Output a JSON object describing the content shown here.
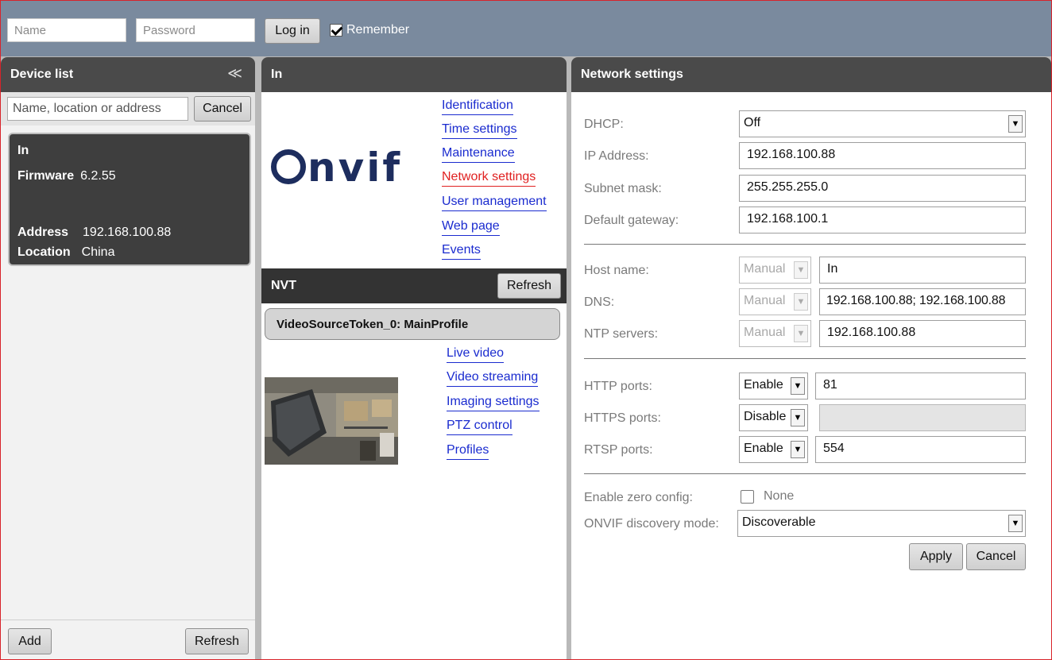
{
  "login": {
    "name_placeholder": "Name",
    "password_placeholder": "Password",
    "login_label": "Log in",
    "remember_label": "Remember"
  },
  "device_list": {
    "title": "Device list",
    "collapse_glyph": "≪",
    "search_placeholder": "Name, location or address",
    "cancel_label": "Cancel",
    "device": {
      "name": "In",
      "firmware_label": "Firmware",
      "firmware": "6.2.55",
      "address_label": "Address",
      "address": "192.168.100.88",
      "location_label": "Location",
      "location": "China"
    },
    "add_label": "Add",
    "refresh_label": "Refresh"
  },
  "device_panel": {
    "title": "In",
    "logo_text": "nvif",
    "links": [
      "Identification",
      "Time settings",
      "Maintenance",
      "Network settings",
      "User management",
      "Web page",
      "Events"
    ],
    "active_link": "Network settings",
    "nvt_title": "NVT",
    "nvt_refresh_label": "Refresh",
    "profile_label": "VideoSourceToken_0: MainProfile",
    "profile_links": [
      "Live video",
      "Video streaming",
      "Imaging settings",
      "PTZ control",
      "Profiles"
    ]
  },
  "network": {
    "title": "Network settings",
    "dhcp_label": "DHCP:",
    "dhcp_value": "Off",
    "ip_label": "IP Address:",
    "ip_value": "192.168.100.88",
    "subnet_label": "Subnet mask:",
    "subnet_value": "255.255.255.0",
    "gateway_label": "Default gateway:",
    "gateway_value": "192.168.100.1",
    "host_label": "Host name:",
    "host_mode": "Manual",
    "host_value": "In",
    "dns_label": "DNS:",
    "dns_mode": "Manual",
    "dns_value": "192.168.100.88; 192.168.100.88",
    "ntp_label": "NTP servers:",
    "ntp_mode": "Manual",
    "ntp_value": "192.168.100.88",
    "http_label": "HTTP ports:",
    "http_mode": "Enable",
    "http_value": "81",
    "https_label": "HTTPS ports:",
    "https_mode": "Disable",
    "https_value": "",
    "rtsp_label": "RTSP ports:",
    "rtsp_mode": "Enable",
    "rtsp_value": "554",
    "zeroconf_label": "Enable zero config:",
    "zeroconf_value": "None",
    "discovery_label": "ONVIF discovery mode:",
    "discovery_value": "Discoverable",
    "apply_label": "Apply",
    "cancel_label": "Cancel"
  }
}
